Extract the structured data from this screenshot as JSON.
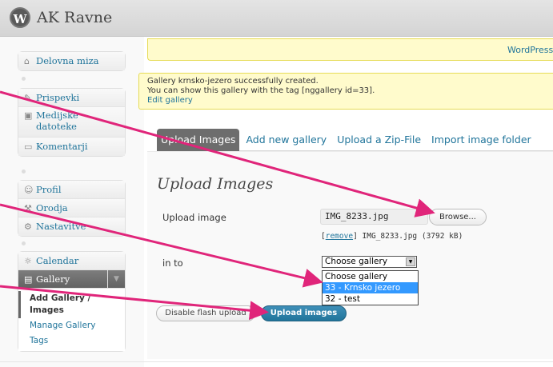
{
  "header": {
    "logo_glyph": "W",
    "site_title": "AK Ravne"
  },
  "sidebar": {
    "dashboard": {
      "icon": "home-icon",
      "label": "Delovna miza"
    },
    "posts": {
      "icon": "pin-icon",
      "label": "Prispevki"
    },
    "media": {
      "icon": "media-icon",
      "label_line1": "Medijske",
      "label_line2": "datoteke"
    },
    "comments": {
      "icon": "comment-icon",
      "label": "Komentarji"
    },
    "profile": {
      "icon": "users-icon",
      "label": "Profil"
    },
    "tools": {
      "icon": "tools-icon",
      "label": "Orodja"
    },
    "settings": {
      "icon": "settings-icon",
      "label": "Nastavitve"
    },
    "calendar": {
      "icon": "calendar-icon",
      "label": "Calendar"
    },
    "gallery": {
      "icon": "gallery-icon",
      "label": "Gallery"
    },
    "gallery_submenu": {
      "add_line1": "Add Gallery /",
      "add_line2": "Images",
      "manage": "Manage Gallery",
      "tags": "Tags"
    }
  },
  "nag": {
    "link": "WordPress"
  },
  "notice": {
    "line1": "Gallery krnsko-jezero successfully created.",
    "line2": "You can show this gallery with the tag [nggallery id=33].",
    "link": "Edit gallery"
  },
  "tabs": [
    "Upload Images",
    "Add new gallery",
    "Upload a Zip-File",
    "Import image folder"
  ],
  "form": {
    "heading": "Upload Images",
    "upload_label": "Upload image",
    "file_value": "IMG_8233.jpg",
    "browse_label": "Browse...",
    "remove_link": "remove",
    "file_meta": "] IMG_8233.jpg (3792 kB)",
    "into_label": "in to",
    "select_value": "Choose gallery",
    "options": [
      "Choose gallery",
      "33 - Krnsko jezero",
      "32 - test"
    ],
    "disable_flash_label": "Disable flash upload",
    "upload_button_label": "Upload images"
  },
  "colors": {
    "accent": "#21759b",
    "arrow": "#e0257a",
    "notice_bg": "#fffbcc",
    "highlight": "#3399ff"
  }
}
